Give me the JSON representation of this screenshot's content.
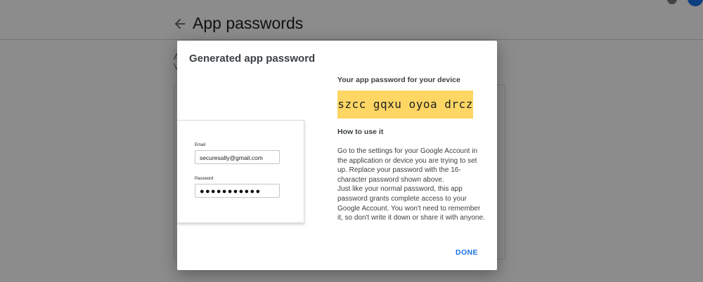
{
  "page": {
    "title": "App passwords",
    "bg_text_line1": "A",
    "bg_text_line2": "V"
  },
  "dialog": {
    "title": "Generated app password",
    "illustration": {
      "email_label": "Email",
      "email_value": "securesally@gmail.com",
      "password_label": "Password",
      "password_value": "●●●●●●●●●●●"
    },
    "password_heading": "Your app password for your device",
    "password_value": "szcc gqxu oyoa drcz",
    "howto_heading": "How to use it",
    "howto_paragraph1": "Go to the settings for your Google Account in the application or device you are trying to set up. Replace your password with the 16-character password shown above.",
    "howto_paragraph2": "Just like your normal password, this app password grants complete access to your Google Account. You won't need to remember it, so don't write it down or share it with anyone.",
    "done_label": "DONE"
  },
  "colors": {
    "accent": "#1a73e8",
    "password_highlight": "#fdd663",
    "scrim": "rgba(0,0,0,0.45)"
  },
  "icons": {
    "back": "arrow-back-icon",
    "avatar": "avatar"
  }
}
